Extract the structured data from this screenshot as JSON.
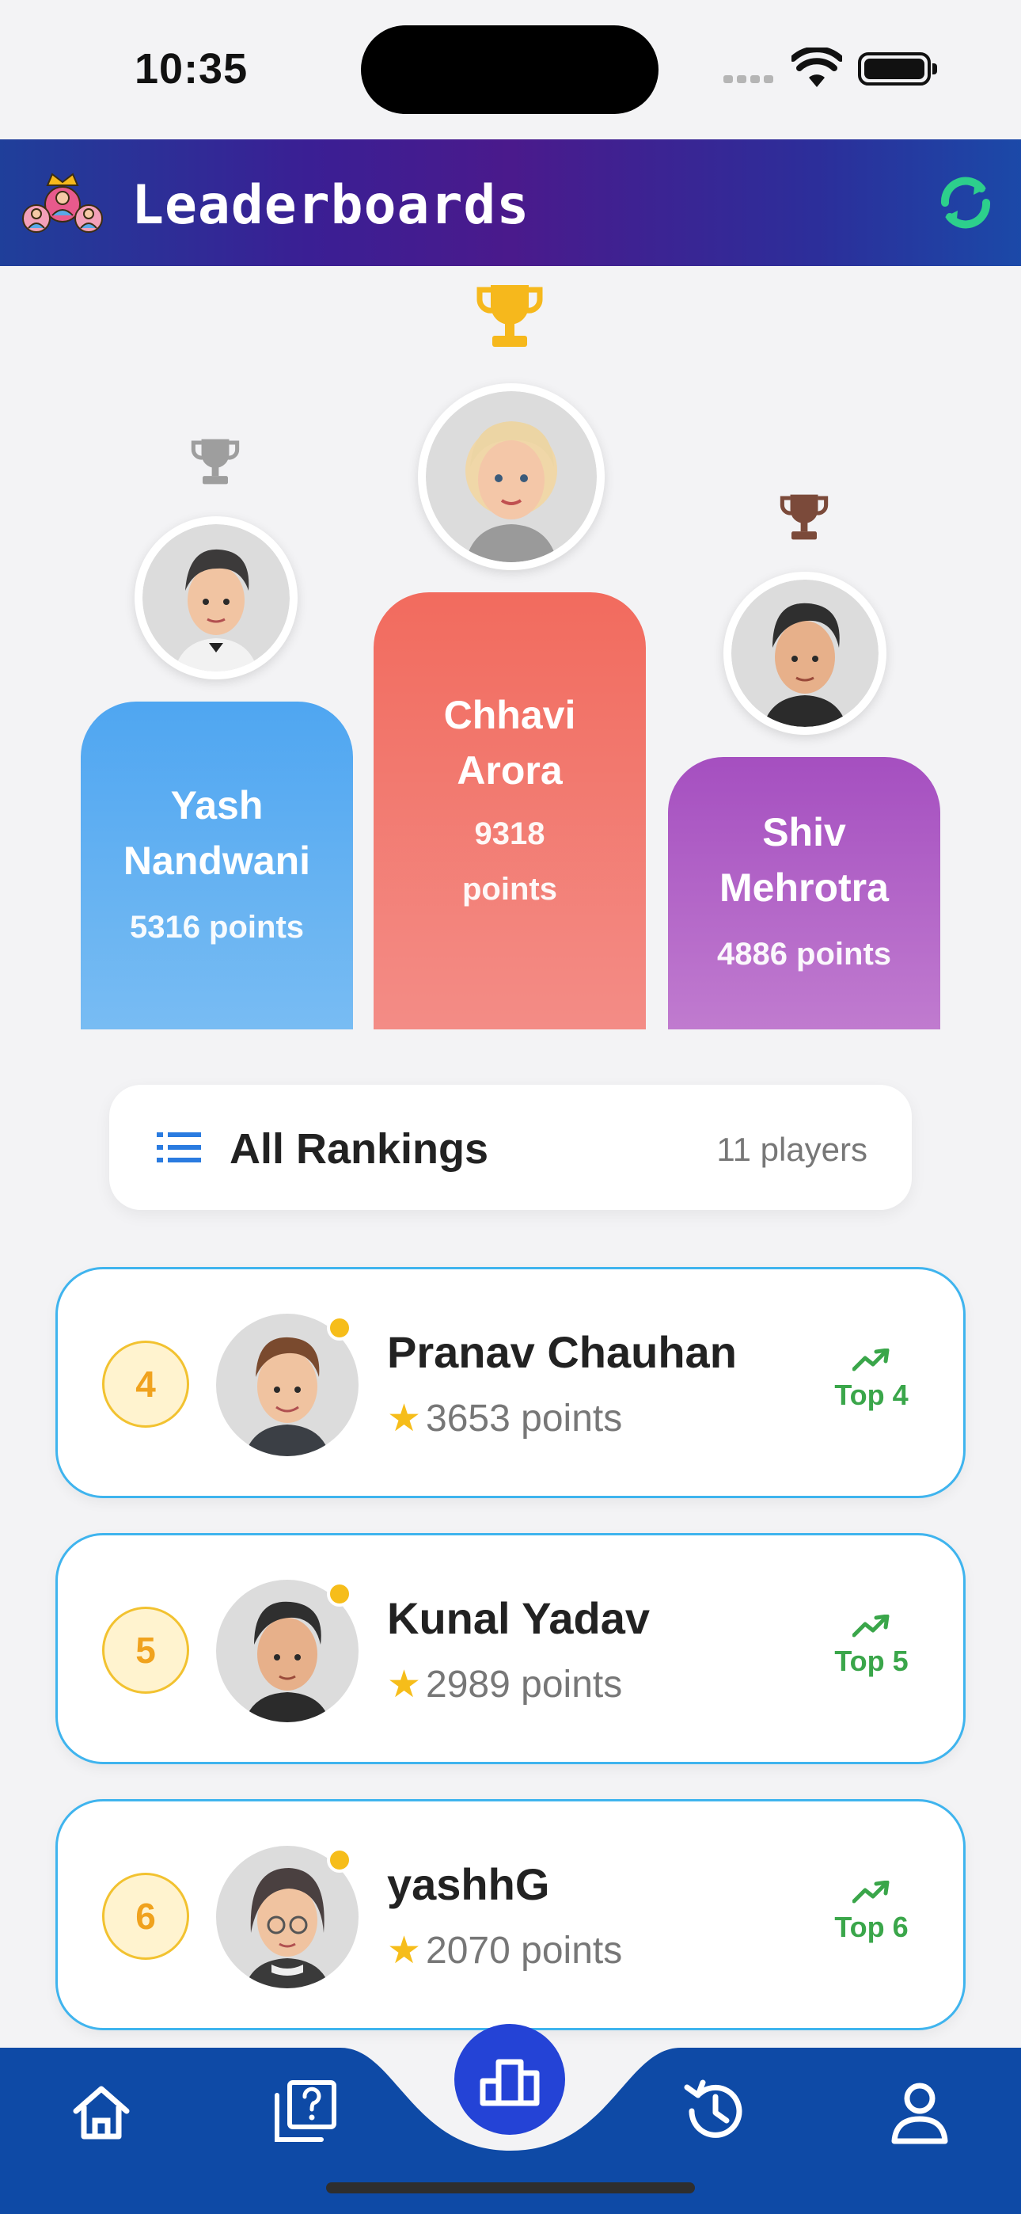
{
  "status_bar": {
    "time": "10:35"
  },
  "app_bar": {
    "title": "Leaderboards",
    "logo_icon": "leaderboard-team-crown-icon",
    "refresh_icon": "refresh-icon"
  },
  "podium": {
    "first": {
      "name_line1": "Chhavi",
      "name_line2": "Arora",
      "points_line1": "9318",
      "points_line2": "points",
      "color": "#f26b5e",
      "trophy_color": "#f6b81c"
    },
    "second": {
      "name_line1": "Yash",
      "name_line2": "Nandwani",
      "points": "5316 points",
      "color": "#52a8f0",
      "trophy_color": "#9e9e9e"
    },
    "third": {
      "name_line1": "Shiv",
      "name_line2": "Mehrotra",
      "points": "4886 points",
      "color": "#a955c2",
      "trophy_color": "#7b4a3a"
    }
  },
  "rankings_header": {
    "title": "All Rankings",
    "count": "11 players"
  },
  "rankings": [
    {
      "rank": "4",
      "name": "Pranav Chauhan",
      "points": "3653 points",
      "trend": "Top 4"
    },
    {
      "rank": "5",
      "name": "Kunal Yadav",
      "points": "2989 points",
      "trend": "Top 5"
    },
    {
      "rank": "6",
      "name": "yashhG",
      "points": "2070 points",
      "trend": "Top 6"
    }
  ],
  "bottom_nav": {
    "items": [
      "home-icon",
      "quiz-question-icon",
      "leaderboard-icon",
      "history-icon",
      "profile-icon"
    ],
    "active": "leaderboard-icon"
  },
  "colors": {
    "nav_bg": "#0e4aa6",
    "accent": "#2443d6",
    "card_border": "#3fb4ee",
    "trend_green": "#3aa64a"
  }
}
